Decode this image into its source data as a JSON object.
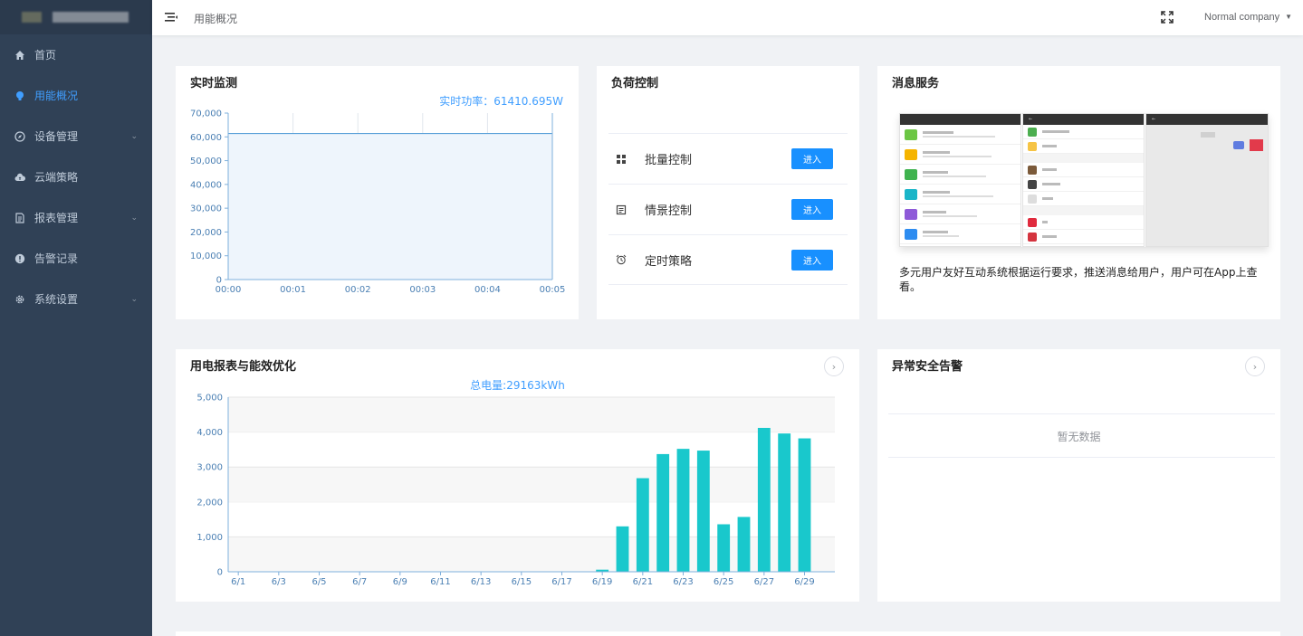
{
  "sidebar": {
    "items": [
      {
        "label": "首页",
        "icon": "home-icon",
        "active": false,
        "has_arrow": false
      },
      {
        "label": "用能概况",
        "icon": "bulb-icon",
        "active": true,
        "has_arrow": false
      },
      {
        "label": "设备管理",
        "icon": "compass-icon",
        "active": false,
        "has_arrow": true
      },
      {
        "label": "云端策略",
        "icon": "cloud-upload-icon",
        "active": false,
        "has_arrow": false
      },
      {
        "label": "报表管理",
        "icon": "document-icon",
        "active": false,
        "has_arrow": true
      },
      {
        "label": "告警记录",
        "icon": "alert-icon",
        "active": false,
        "has_arrow": false
      },
      {
        "label": "系统设置",
        "icon": "gear-icon",
        "active": false,
        "has_arrow": true
      }
    ]
  },
  "header": {
    "breadcrumb": "用能概况",
    "company": "Normal company"
  },
  "realtime": {
    "title": "实时监测",
    "power_label": "实时功率：61410.695W"
  },
  "load_control": {
    "title": "负荷控制",
    "rows": [
      {
        "label": "批量控制",
        "button": "进入",
        "icon": "grid-icon"
      },
      {
        "label": "情景控制",
        "button": "进入",
        "icon": "scene-icon"
      },
      {
        "label": "定时策略",
        "button": "进入",
        "icon": "alarm-clock-icon"
      }
    ]
  },
  "message_service": {
    "title": "消息服务",
    "description": "多元用户友好互动系统根据运行要求，推送消息给用户，用户可在App上查看。"
  },
  "report": {
    "title": "用电报表与能效优化",
    "total_label": "总电量:29163kWh"
  },
  "alarm": {
    "title": "异常安全告警",
    "empty": "暂无数据"
  },
  "colors": {
    "sidebar_bg": "#304156",
    "accent": "#409eff",
    "bar": "#19c8cc",
    "line": "#5aa0d8"
  },
  "chart_data": [
    {
      "type": "area",
      "x": [
        "00:00",
        "00:01",
        "00:02",
        "00:03",
        "00:04",
        "00:05"
      ],
      "values": [
        61410,
        61410,
        61410,
        61410,
        61410,
        61410
      ],
      "ylim": [
        0,
        70000
      ],
      "yticks": [
        "0",
        "10,000",
        "20,000",
        "30,000",
        "40,000",
        "50,000",
        "60,000",
        "70,000"
      ],
      "grid": true
    },
    {
      "type": "bar",
      "categories": [
        "6/1",
        "6/2",
        "6/3",
        "6/4",
        "6/5",
        "6/6",
        "6/7",
        "6/8",
        "6/9",
        "6/10",
        "6/11",
        "6/12",
        "6/13",
        "6/14",
        "6/15",
        "6/16",
        "6/17",
        "6/18",
        "6/19",
        "6/20",
        "6/21",
        "6/22",
        "6/23",
        "6/24",
        "6/25",
        "6/26",
        "6/27",
        "6/28",
        "6/29",
        "6/30"
      ],
      "tick_labels": [
        "6/1",
        "6/3",
        "6/5",
        "6/7",
        "6/9",
        "6/11",
        "6/13",
        "6/15",
        "6/17",
        "6/19",
        "6/21",
        "6/23",
        "6/25",
        "6/27",
        "6/29"
      ],
      "values": [
        0,
        0,
        0,
        0,
        0,
        0,
        0,
        0,
        0,
        0,
        0,
        0,
        0,
        0,
        0,
        0,
        0,
        0,
        60,
        1300,
        2680,
        3370,
        3520,
        3470,
        1360,
        1570,
        4120,
        3960,
        3820,
        0
      ],
      "ylim": [
        0,
        5000
      ],
      "yticks": [
        "0",
        "1,000",
        "2,000",
        "3,000",
        "4,000",
        "5,000"
      ],
      "grid": true
    }
  ]
}
